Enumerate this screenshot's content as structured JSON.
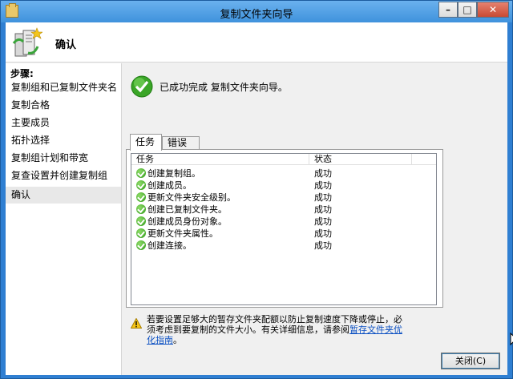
{
  "window": {
    "title": "复制文件夹向导",
    "controls": {
      "minimize": "–",
      "maximize": "□",
      "close": "✕"
    }
  },
  "header": {
    "title": "确认",
    "icon": "wizard-server-icon"
  },
  "sidebar": {
    "label": "步骤:",
    "items": [
      {
        "label": "复制组和已复制文件夹名",
        "active": false
      },
      {
        "label": "复制合格",
        "active": false
      },
      {
        "label": "主要成员",
        "active": false
      },
      {
        "label": "拓扑选择",
        "active": false
      },
      {
        "label": "复制组计划和带宽",
        "active": false
      },
      {
        "label": "复查设置并创建复制组",
        "active": false
      },
      {
        "label": "确认",
        "active": true
      }
    ]
  },
  "main": {
    "success_message": "已成功完成 复制文件夹向导。",
    "tabs": [
      {
        "label": "任务"
      },
      {
        "label": "错误"
      }
    ],
    "table": {
      "columns": [
        "任务",
        "状态"
      ],
      "rows": [
        {
          "task": "创建复制组。",
          "status": "成功"
        },
        {
          "task": "创建成员。",
          "status": "成功"
        },
        {
          "task": "更新文件夹安全级别。",
          "status": "成功"
        },
        {
          "task": "创建已复制文件夹。",
          "status": "成功"
        },
        {
          "task": "创建成员身份对象。",
          "status": "成功"
        },
        {
          "task": "更新文件夹属性。",
          "status": "成功"
        },
        {
          "task": "创建连接。",
          "status": "成功"
        }
      ]
    },
    "warning": {
      "text_before": "若要设置足够大的暂存文件夹配额以防止复制速度下降或停止，必须考虑到要复制的文件大小。有关详细信息，请参阅",
      "link": "暂存文件夹优化指南",
      "text_after": "。"
    },
    "close_button": "关闭(C)"
  },
  "colors": {
    "accent": "#2f7fd2",
    "success": "#2f9a18",
    "link": "#0a4fc2"
  }
}
